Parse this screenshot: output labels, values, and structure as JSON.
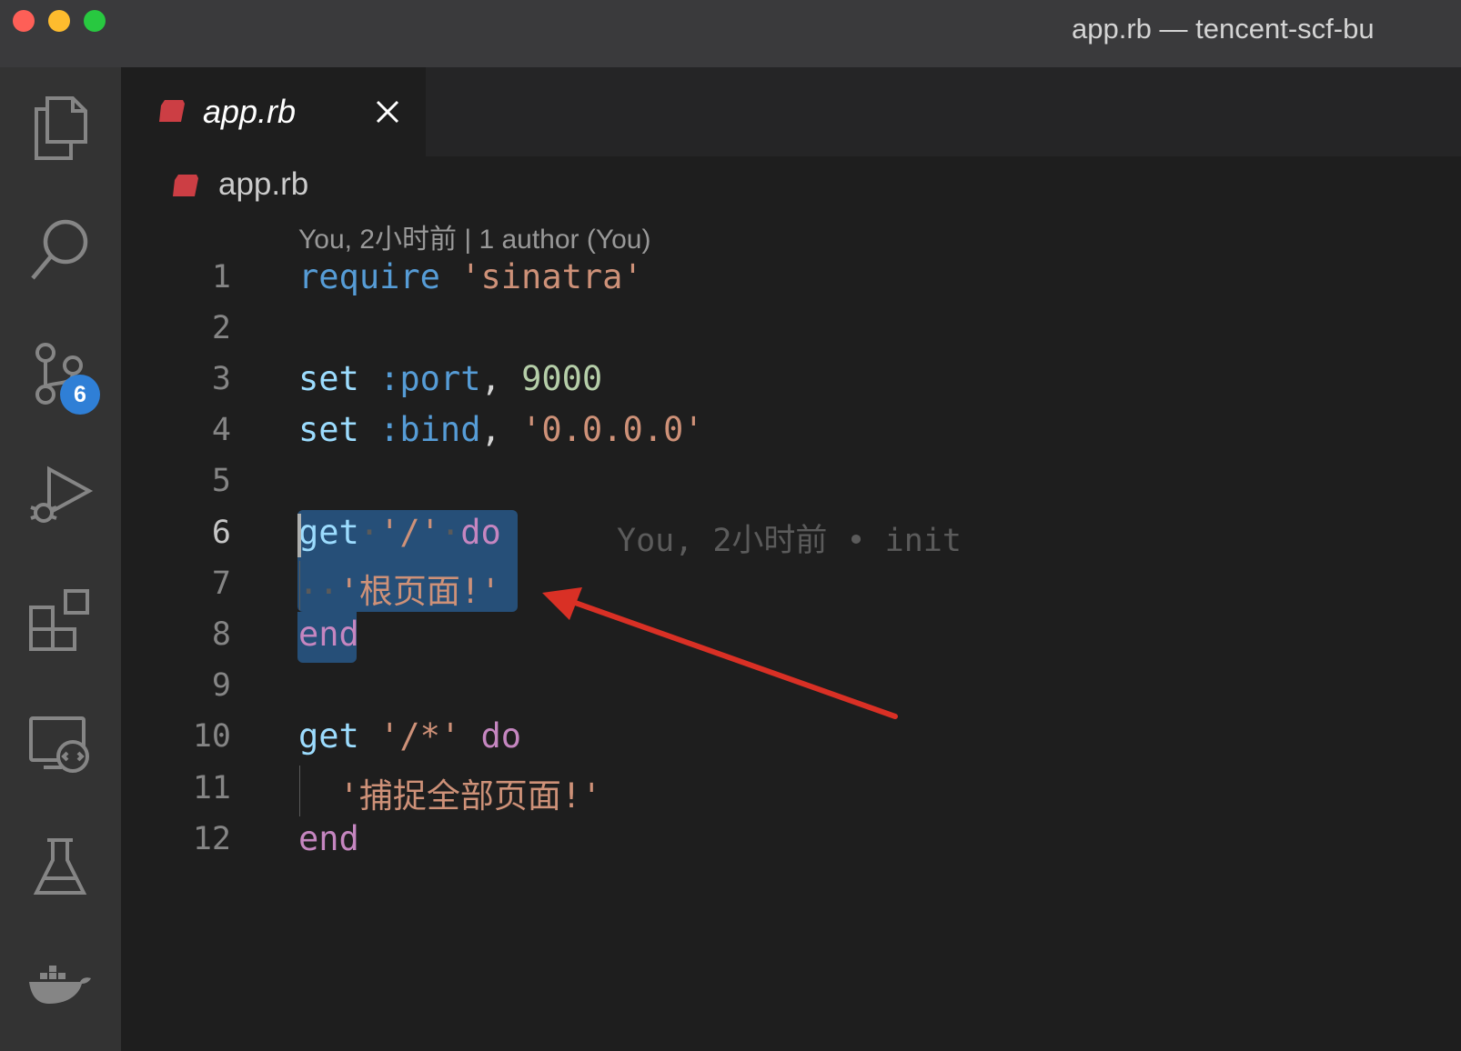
{
  "window": {
    "title": "app.rb — tencent-scf-bu"
  },
  "activity_bar": {
    "source_control_badge": "6"
  },
  "tab": {
    "label": "app.rb"
  },
  "breadcrumb": {
    "file": "app.rb"
  },
  "codelens": "You, 2小时前 | 1 author (You)",
  "editor": {
    "line_numbers": [
      "1",
      "2",
      "3",
      "4",
      "5",
      "6",
      "7",
      "8",
      "9",
      "10",
      "11",
      "12"
    ],
    "active_line": "6",
    "lines": {
      "l1": {
        "kw": "require",
        "str": "'sinatra'"
      },
      "l3": {
        "kw": "set",
        "sym": ":port",
        "comma": ",",
        "num": "9000"
      },
      "l4": {
        "kw": "set",
        "sym": ":bind",
        "comma": ",",
        "str": "'0.0.0.0'"
      },
      "l6": {
        "kw": "get",
        "str": "'/'",
        "do": "do"
      },
      "l7": {
        "str": "'根页面!'"
      },
      "l8": {
        "end": "end"
      },
      "l10": {
        "kw": "get",
        "str": "'/*'",
        "do": "do"
      },
      "l11": {
        "str": "'捕捉全部页面!'"
      },
      "l12": {
        "end": "end"
      }
    },
    "inline_blame": "You, 2小时前 • init"
  },
  "colors": {
    "editor_bg": "#1e1e1e",
    "activity_bar_bg": "#333333",
    "selection": "#264f78",
    "badge": "#2f7fd6",
    "arrow": "#d93025"
  }
}
